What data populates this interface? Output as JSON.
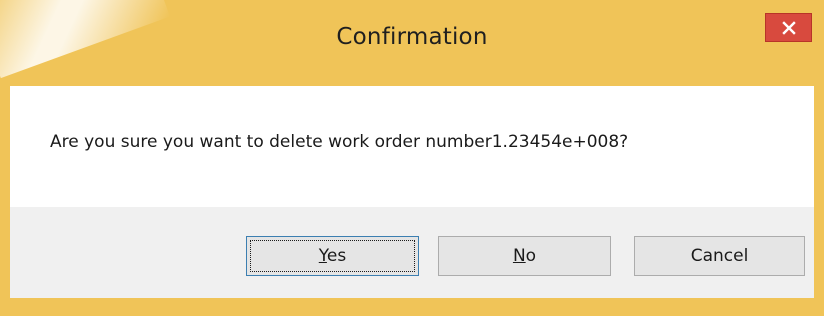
{
  "dialog": {
    "title": "Confirmation",
    "message": "Are you sure you want to delete work order number1.23454e+008?",
    "close_icon": "close-icon"
  },
  "buttons": {
    "yes": {
      "accel": "Y",
      "rest": "es"
    },
    "no": {
      "accel": "N",
      "rest": "o"
    },
    "cancel": {
      "label": "Cancel"
    }
  },
  "colors": {
    "frame": "#f0c458",
    "close": "#d84a3e",
    "button_bar": "#f0f0f0",
    "focus_border": "#3c7fb1"
  }
}
